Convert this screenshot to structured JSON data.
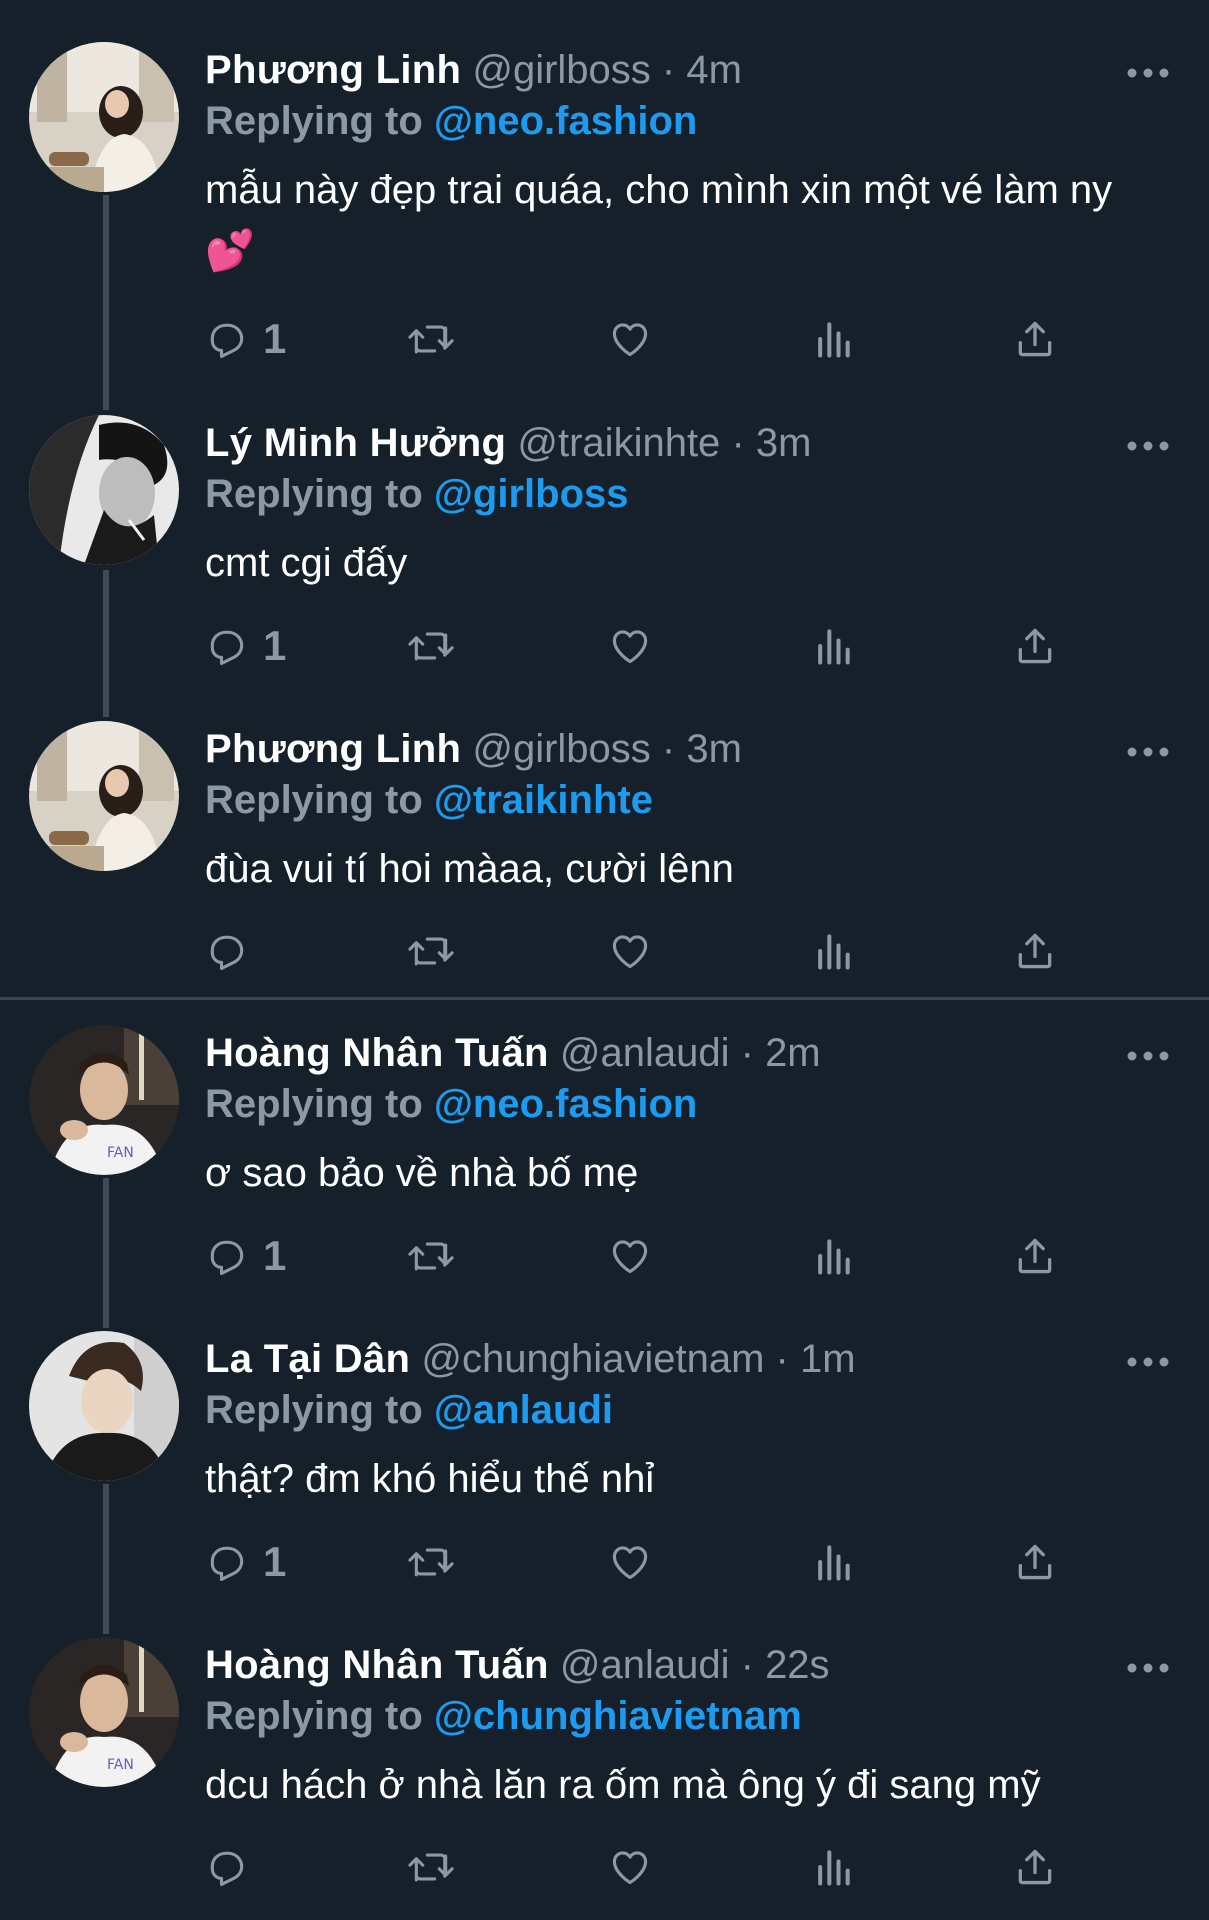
{
  "colors": {
    "background": "#15202b",
    "text_primary": "#ffffff",
    "text_secondary": "#8b98a5",
    "mention": "#1d9bf0",
    "thread_line": "#3d4a57",
    "divider": "#38444d"
  },
  "tweets": [
    {
      "name": "Phương Linh",
      "handle": "@girlboss",
      "dot": "·",
      "time": "4m",
      "reply_label": "Replying to",
      "reply_to": "@neo.fashion",
      "text": "mẫu này đẹp trai quáa, cho mình xin một vé làm ny💕",
      "reply_count": "1",
      "avatar_icon": "avatar-photo"
    },
    {
      "name": "Lý Minh Hưởng",
      "handle": "@traikinhte",
      "dot": "·",
      "time": "3m",
      "reply_label": "Replying to",
      "reply_to": "@girlboss",
      "text": "cmt cgi đấy",
      "reply_count": "1",
      "avatar_icon": "avatar-photo"
    },
    {
      "name": "Phương Linh",
      "handle": "@girlboss",
      "dot": "·",
      "time": "3m",
      "reply_label": "Replying to",
      "reply_to": "@traikinhte",
      "text": "đùa vui tí hoi màaa, cười lênn",
      "reply_count": "",
      "avatar_icon": "avatar-photo"
    },
    {
      "name": "Hoàng Nhân Tuấn",
      "handle": "@anlaudi",
      "dot": "·",
      "time": "2m",
      "reply_label": "Replying to",
      "reply_to": "@neo.fashion",
      "text": "ơ sao bảo về nhà bố mẹ",
      "reply_count": "1",
      "avatar_icon": "avatar-photo"
    },
    {
      "name": "La Tại Dân",
      "handle": "@chunghiavietnam",
      "dot": "·",
      "time": "1m",
      "reply_label": "Replying to",
      "reply_to": "@anlaudi",
      "text": "thật? đm khó hiểu thế nhỉ",
      "reply_count": "1",
      "avatar_icon": "avatar-photo"
    },
    {
      "name": "Hoàng Nhân Tuấn",
      "handle": "@anlaudi",
      "dot": "·",
      "time": "22s",
      "reply_label": "Replying to",
      "reply_to": "@chunghiavietnam",
      "text": "dcu hách ở nhà lăn ra ốm mà ông ý đi sang mỹ",
      "reply_count": "",
      "avatar_icon": "avatar-photo"
    }
  ],
  "action_icons": [
    "reply-icon",
    "retweet-icon",
    "like-icon",
    "analytics-icon",
    "share-icon"
  ],
  "more_icon": "more-options-icon"
}
